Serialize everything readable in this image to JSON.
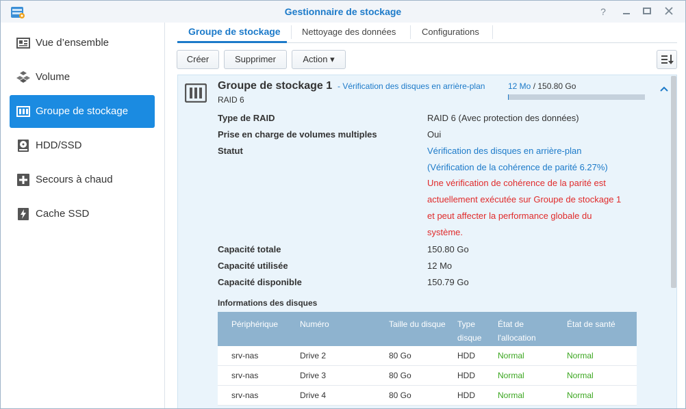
{
  "window": {
    "title": "Gestionnaire de stockage"
  },
  "sidebar": {
    "items": [
      {
        "label": "Vue d’ensemble",
        "icon": "overview-icon"
      },
      {
        "label": "Volume",
        "icon": "cubes-icon"
      },
      {
        "label": "Groupe de stockage",
        "icon": "storage-pool-icon",
        "active": true
      },
      {
        "label": "HDD/SSD",
        "icon": "hdd-icon"
      },
      {
        "label": "Secours à chaud",
        "icon": "hot-spare-icon"
      },
      {
        "label": "Cache SSD",
        "icon": "ssd-cache-icon"
      }
    ]
  },
  "tabs": [
    {
      "label": "Groupe de stockage",
      "active": true
    },
    {
      "label": "Nettoyage des données"
    },
    {
      "label": "Configurations"
    }
  ],
  "toolbar": {
    "create_label": "Créer",
    "delete_label": "Supprimer",
    "action_label": "Action ▾"
  },
  "pool": {
    "name": "Groupe de stockage 1",
    "status_inline": "- Vérification des disques en arrière-plan",
    "raid": "RAID 6",
    "usage_used": "12 Mo",
    "usage_sep": " / ",
    "usage_total": "150.80 Go",
    "usage_fraction": 0.0001,
    "properties": {
      "raid_type_label": "Type de RAID",
      "raid_type_value": "RAID 6 (Avec protection des données)",
      "multi_volume_label": "Prise en charge de volumes multiples",
      "multi_volume_value": "Oui",
      "status_label": "Statut",
      "status_line1": "Vérification des disques en arrière-plan",
      "status_line2": "(Vérification de la cohérence de parité 6.27%)",
      "status_warning_1": "Une vérification de cohérence de la parité est",
      "status_warning_2": "actuellement exécutée sur Groupe de stockage 1",
      "status_warning_3": "et peut affecter la performance globale du",
      "status_warning_4": "système.",
      "total_label": "Capacité totale",
      "total_value": "150.80 Go",
      "used_label": "Capacité utilisée",
      "used_value": "12 Mo",
      "available_label": "Capacité disponible",
      "available_value": "150.79 Go"
    },
    "disk_info_title": "Informations des disques",
    "disk_table": {
      "headers": {
        "device": "Périphérique",
        "number": "Numéro",
        "size": "Taille du disque",
        "type_1": "Type",
        "type_2": "disque",
        "alloc_1": "État de",
        "alloc_2": "l'allocation",
        "health": "État de santé"
      },
      "rows": [
        {
          "device": "srv-nas",
          "number": "Drive 2",
          "size": "80 Go",
          "type": "HDD",
          "alloc": "Normal",
          "health": "Normal"
        },
        {
          "device": "srv-nas",
          "number": "Drive 3",
          "size": "80 Go",
          "type": "HDD",
          "alloc": "Normal",
          "health": "Normal"
        },
        {
          "device": "srv-nas",
          "number": "Drive 4",
          "size": "80 Go",
          "type": "HDD",
          "alloc": "Normal",
          "health": "Normal"
        }
      ]
    }
  },
  "colors": {
    "accent": "#1c7ac9",
    "active_nav": "#1b8be1",
    "warning": "#e02a2a",
    "ok": "#3aa61f",
    "table_header": "#8eb3cf"
  }
}
